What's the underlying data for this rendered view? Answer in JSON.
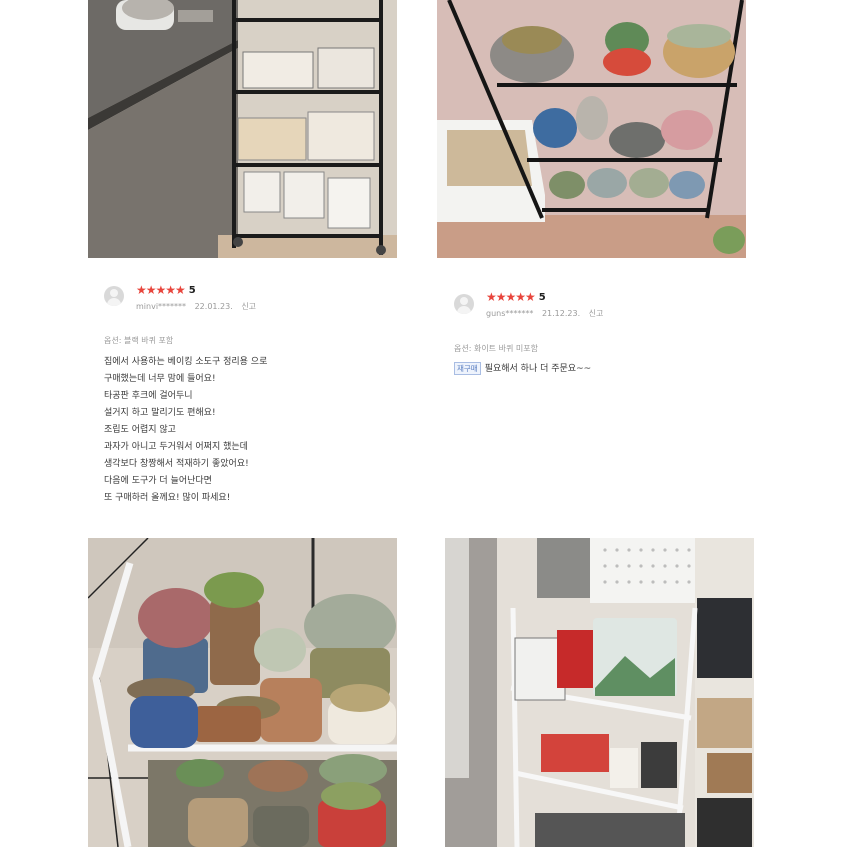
{
  "reviews": [
    {
      "rating": "5",
      "stars": "★★★★★",
      "user": "minvi*******",
      "date": "22.01.23.",
      "report_label": "신고",
      "option": "옵션: 블랙 바퀴 포함",
      "lines": [
        "집에서 사용하는 베이킹 소도구 정리용 으로",
        "구매했는데 너무 맘에 들어요!",
        "타공판 후크에 걸어두니",
        "설거지 하고 말리기도 편해요!",
        "조립도 어렵지 않고",
        "과자가 아니고 두거워서 어쩌지 했는데",
        "생각보다 창짱해서 적재하기 좋았어요!",
        "다음에 도구가 더 늘어난다면",
        "또 구매하러 올께요! 많이 파세요!"
      ]
    },
    {
      "rating": "5",
      "stars": "★★★★★",
      "user": "guns*******",
      "date": "21.12.23.",
      "report_label": "신고",
      "option": "옵션: 화이트 바퀴 미포함",
      "tag": "재구매",
      "text": "필요해서 하나 더 주문요~~"
    }
  ],
  "photos": [
    {
      "alt": "black-cart-kitchen-photo"
    },
    {
      "alt": "black-shelf-succulents-photo"
    },
    {
      "alt": "white-shelf-succulents-photo"
    },
    {
      "alt": "white-cart-storage-photo"
    }
  ]
}
